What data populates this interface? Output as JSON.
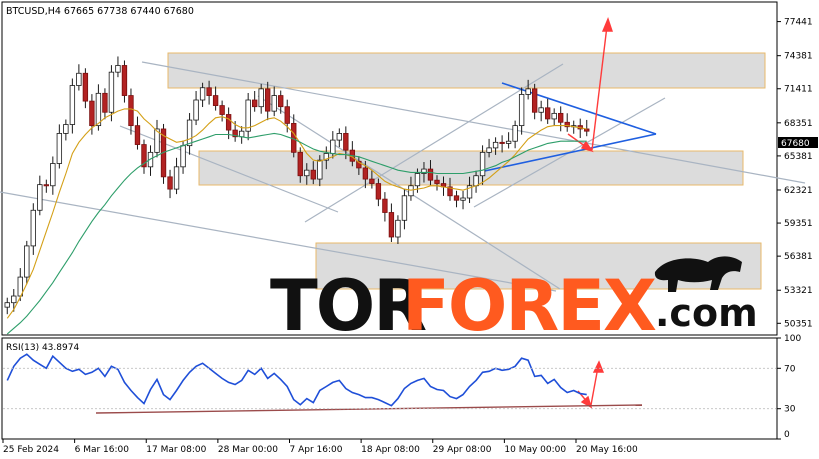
{
  "chart_data": [
    {
      "type": "candlestick",
      "symbol_info": "BTCUSD,H4  67665 67738 67440 67680",
      "ylim": [
        49300,
        79200
      ],
      "y_ticks": [
        50351,
        53321,
        56381,
        59351,
        62321,
        65381,
        68351,
        71411,
        74381,
        77441
      ],
      "y_tick_labels": [
        "50351",
        "53321",
        "56381",
        "59351",
        "62321",
        "65381",
        "68351",
        "71411",
        "74381",
        "77441"
      ],
      "current_price": 67680,
      "current_price_label": "67680",
      "x_tick_labels": [
        "25 Feb 2024",
        "6 Mar 16:00",
        "17 Mar 08:00",
        "28 Mar 00:00",
        "7 Apr 16:00",
        "18 Apr 08:00",
        "29 Apr 08:00",
        "10 May 00:00",
        "20 May 16:00"
      ],
      "series": [
        {
          "color": "#1a1a1a",
          "values": [
            52200,
            52800,
            54500,
            57300,
            60500,
            62800,
            62700,
            64700,
            67400,
            68200,
            71700,
            72800,
            70300,
            68100,
            71000,
            69300,
            72900,
            73500,
            70800,
            68100,
            66400,
            64400,
            65700,
            67800,
            63500,
            62400,
            64400,
            66300,
            68600,
            70400,
            71500,
            70800,
            69900,
            69100,
            67700,
            67100,
            67600,
            70400,
            69800,
            71400,
            69400,
            70800,
            69800,
            68300,
            65700,
            63600,
            64100,
            63300,
            65000,
            65600,
            66800,
            67400,
            65900,
            64900,
            64300,
            63300,
            62900,
            61500,
            60300,
            58100,
            59600,
            61800,
            62700,
            63800,
            64200,
            63200,
            62900,
            62600,
            61800,
            61400,
            61600,
            62700,
            63600,
            65700,
            66100,
            66600,
            66500,
            66700,
            68100,
            70900,
            71400,
            69300,
            69700,
            68700,
            69200,
            68400,
            68000,
            68100,
            67800,
            67600
          ]
        },
        {
          "name": "",
          "color": "#d4a017",
          "values": [
            50800,
            51600,
            52700,
            53900,
            55200,
            56900,
            58600,
            60300,
            62100,
            63800,
            65600,
            66600,
            67300,
            67900,
            68300,
            68800,
            69100,
            69400,
            69600,
            69600,
            69400,
            68700,
            68200,
            67600,
            67200,
            66900,
            66600,
            66700,
            66900,
            67200,
            67700,
            68300,
            68800,
            68900,
            68700,
            68200,
            67900,
            67900,
            68100,
            68400,
            68700,
            68800,
            68500,
            68000,
            67400,
            66500,
            65600,
            65000,
            64900,
            65100,
            65300,
            65600,
            65500,
            65300,
            64800,
            64500,
            64100,
            63600,
            63100,
            62800,
            62600,
            62400,
            62300,
            62400,
            62500,
            62700,
            62700,
            62600,
            62500,
            62400,
            62300,
            62500,
            62700,
            63000,
            63400,
            63900,
            64400,
            64900,
            65500,
            66200,
            66900,
            67300,
            67700,
            68000,
            68100,
            68100,
            68100,
            68000,
            67900,
            67800
          ]
        },
        {
          "name": "",
          "color": "#2e9e6a",
          "values": [
            49400,
            49900,
            50400,
            51000,
            51700,
            52400,
            53200,
            54000,
            54900,
            55800,
            56700,
            57700,
            58600,
            59500,
            60300,
            61000,
            61800,
            62500,
            63200,
            63800,
            64300,
            64700,
            65100,
            65400,
            65700,
            65900,
            66100,
            66300,
            66500,
            66700,
            66900,
            67100,
            67300,
            67300,
            67300,
            67200,
            67100,
            67000,
            67100,
            67200,
            67300,
            67400,
            67300,
            67100,
            66900,
            66600,
            66300,
            66000,
            65800,
            65700,
            65600,
            65500,
            65500,
            65400,
            65300,
            65100,
            64900,
            64700,
            64500,
            64300,
            64100,
            64000,
            63900,
            63900,
            63900,
            63900,
            63800,
            63800,
            63800,
            63800,
            63800,
            63900,
            64000,
            64100,
            64300,
            64500,
            64800,
            65000,
            65300,
            65600,
            65900,
            66100,
            66300,
            66500,
            66600,
            66700,
            66700,
            66700,
            66700,
            66700
          ]
        }
      ]
    },
    {
      "type": "line",
      "title": "RSI(13) 43.8974",
      "ylim": [
        0,
        100
      ],
      "y_ticks": [
        0,
        30,
        70,
        100
      ],
      "y_tick_labels": [
        "0",
        "30",
        "70",
        "100"
      ],
      "series": [
        {
          "color": "#1f4fd8",
          "values": [
            58,
            72,
            80,
            84,
            78,
            74,
            70,
            82,
            76,
            70,
            67,
            69,
            64,
            66,
            70,
            62,
            72,
            69,
            56,
            48,
            41,
            35,
            49,
            59,
            44,
            39,
            48,
            58,
            66,
            72,
            75,
            70,
            65,
            60,
            56,
            54,
            58,
            68,
            64,
            70,
            60,
            65,
            59,
            52,
            39,
            34,
            40,
            36,
            48,
            52,
            56,
            58,
            50,
            46,
            44,
            41,
            41,
            39,
            36,
            33,
            40,
            50,
            55,
            58,
            60,
            52,
            49,
            48,
            42,
            40,
            44,
            52,
            58,
            66,
            67,
            70,
            68,
            69,
            72,
            80,
            78,
            62,
            63,
            55,
            59,
            51,
            46,
            48,
            45,
            44
          ]
        }
      ]
    }
  ],
  "watermark_text": "TORFOREX.com"
}
